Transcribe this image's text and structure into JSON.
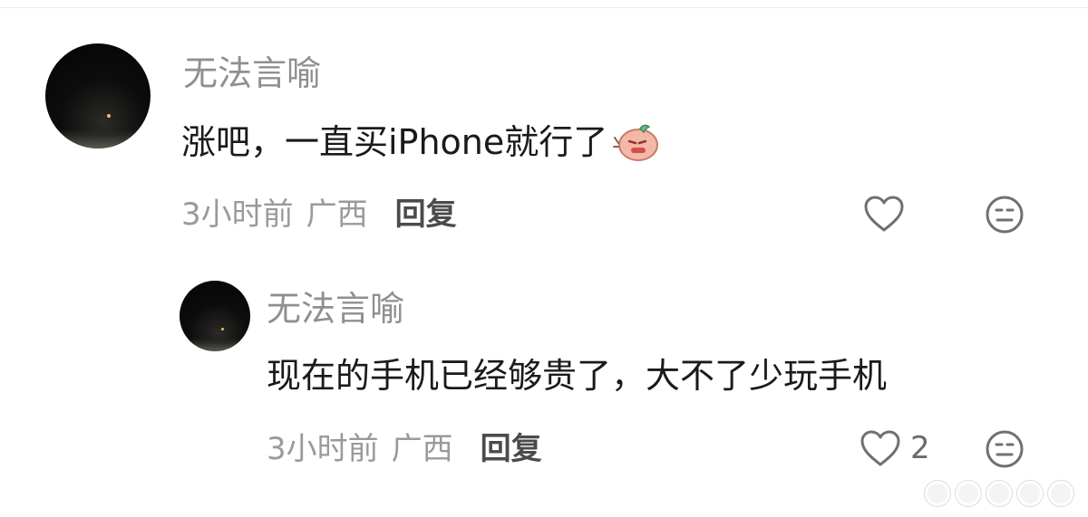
{
  "comments": [
    {
      "author": "无法言喻",
      "text": "涨吧，一直买iPhone就行了",
      "emoji": "doge-emoji",
      "time": "3小时前",
      "location": "广西",
      "reply_label": "回复",
      "likes": ""
    },
    {
      "author": "无法言喻",
      "text": "现在的手机已经够贵了，大不了少玩手机",
      "time": "3小时前",
      "location": "广西",
      "reply_label": "回复",
      "likes": "2"
    }
  ],
  "icons": {
    "like": "heart-outline-icon",
    "dislike": "neutral-face-icon"
  },
  "colors": {
    "author": "#8f8f8f",
    "text": "#1a1a1a",
    "meta": "#9a9a9a",
    "reply": "#4b4b4b"
  }
}
